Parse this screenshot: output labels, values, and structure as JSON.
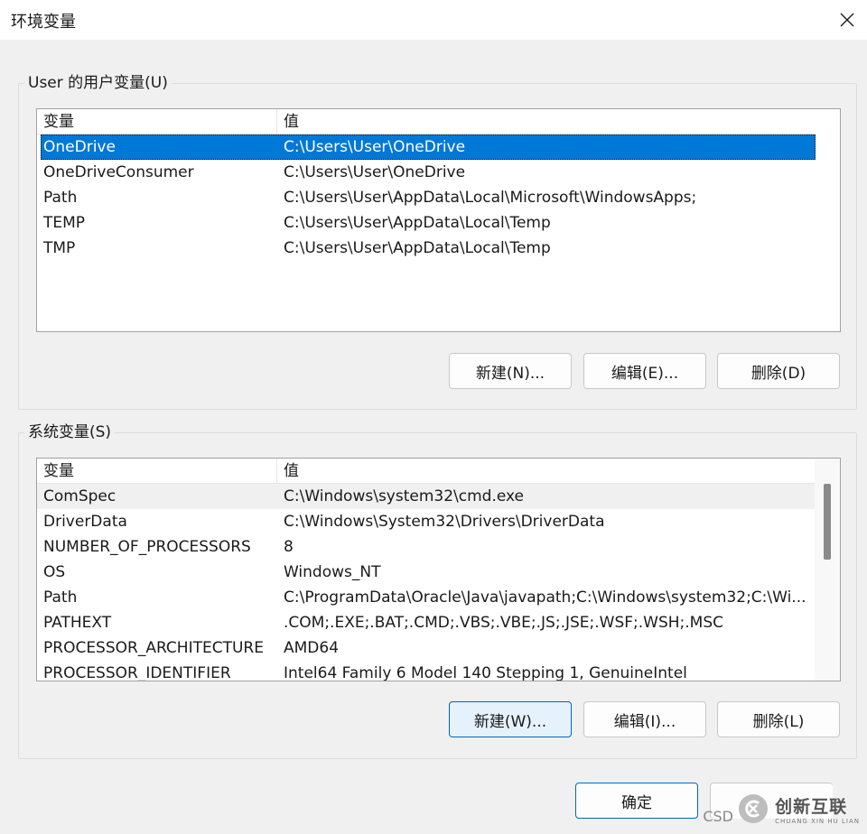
{
  "window": {
    "title": "环境变量"
  },
  "user_section": {
    "label": "User 的用户变量(U)",
    "header": {
      "col1": "变量",
      "col2": "值"
    },
    "rows": [
      {
        "name": "OneDrive",
        "value": "C:\\Users\\User\\OneDrive"
      },
      {
        "name": "OneDriveConsumer",
        "value": "C:\\Users\\User\\OneDrive"
      },
      {
        "name": "Path",
        "value": "C:\\Users\\User\\AppData\\Local\\Microsoft\\WindowsApps;"
      },
      {
        "name": "TEMP",
        "value": "C:\\Users\\User\\AppData\\Local\\Temp"
      },
      {
        "name": "TMP",
        "value": "C:\\Users\\User\\AppData\\Local\\Temp"
      }
    ],
    "buttons": {
      "new": "新建(N)...",
      "edit": "编辑(E)...",
      "delete": "删除(D)"
    }
  },
  "system_section": {
    "label": "系统变量(S)",
    "header": {
      "col1": "变量",
      "col2": "值"
    },
    "rows": [
      {
        "name": "ComSpec",
        "value": "C:\\Windows\\system32\\cmd.exe"
      },
      {
        "name": "DriverData",
        "value": "C:\\Windows\\System32\\Drivers\\DriverData"
      },
      {
        "name": "NUMBER_OF_PROCESSORS",
        "value": "8"
      },
      {
        "name": "OS",
        "value": "Windows_NT"
      },
      {
        "name": "Path",
        "value": "C:\\ProgramData\\Oracle\\Java\\javapath;C:\\Windows\\system32;C:\\Wi..."
      },
      {
        "name": "PATHEXT",
        "value": ".COM;.EXE;.BAT;.CMD;.VBS;.VBE;.JS;.JSE;.WSF;.WSH;.MSC"
      },
      {
        "name": "PROCESSOR_ARCHITECTURE",
        "value": "AMD64"
      },
      {
        "name": "PROCESSOR_IDENTIFIER",
        "value": "Intel64 Family 6 Model 140 Stepping 1, GenuineIntel"
      }
    ],
    "buttons": {
      "new": "新建(W)...",
      "edit": "编辑(I)...",
      "delete": "删除(L)"
    }
  },
  "footer": {
    "ok": "确定"
  },
  "watermark": {
    "brand": "创新互联",
    "sub": "CHUANG XIN HU LIAN",
    "csdn": "CSD"
  },
  "colors": {
    "selection": "#0078d7",
    "accent": "#0067c0"
  }
}
